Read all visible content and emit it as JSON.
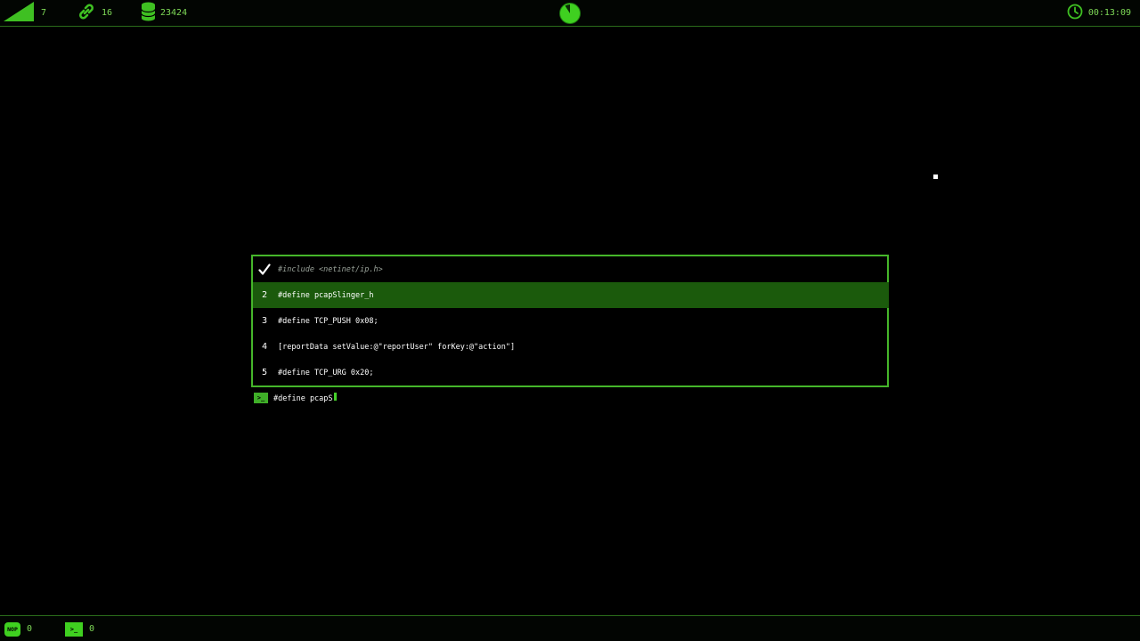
{
  "topbar": {
    "level": {
      "icon": "signal-bars-icon",
      "value": "7"
    },
    "links": {
      "icon": "chain-link-icon",
      "value": "16"
    },
    "data": {
      "icon": "database-icon",
      "value": "23424"
    },
    "timer_icon": "timer-pie-icon",
    "clock": {
      "icon": "clock-icon",
      "value": "00:13:09"
    }
  },
  "code_panel": {
    "rows": [
      {
        "number": "",
        "marker_icon": "checkmark-icon",
        "text": "#include <netinet/ip.h>",
        "state": "completed"
      },
      {
        "number": "2",
        "text": "#define pcapSlinger_h",
        "state": "active"
      },
      {
        "number": "3",
        "text": "#define TCP_PUSH 0x08;",
        "state": "pending"
      },
      {
        "number": "4",
        "text": "[reportData setValue:@\"reportUser\" forKey:@\"action\"]",
        "state": "pending"
      },
      {
        "number": "5",
        "text": "#define TCP_URG 0x20;",
        "state": "pending"
      }
    ]
  },
  "prompt": {
    "icon": "terminal-prompt-icon",
    "icon_label": ">_",
    "typed_text": "#define pcapS"
  },
  "bottombar": {
    "nop": {
      "badge_label": "NOP",
      "value": "0"
    },
    "terminal": {
      "badge_label": ">_",
      "value": "0"
    }
  },
  "colors": {
    "accent": "#45b62a",
    "active_row": "#1b5a0c",
    "text": "#ffffff",
    "hud_text": "#7ed957"
  }
}
